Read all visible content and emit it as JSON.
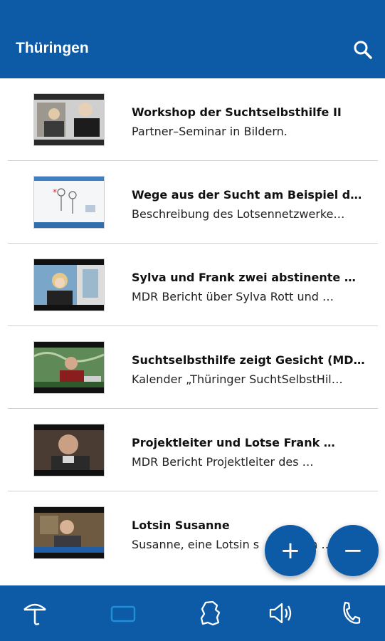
{
  "appbar": {
    "title": "Thüringen",
    "search_icon": "search-icon"
  },
  "items": [
    {
      "title": "Workshop der Suchtselbsthilfe II",
      "subtitle": "Partner–Seminar in Bildern."
    },
    {
      "title": "Wege aus der Sucht am Beispiel d…",
      "subtitle": "Beschreibung des Lotsennetzwerke…"
    },
    {
      "title": "Sylva und Frank   zwei abstinente …",
      "subtitle": "MDR Bericht über Sylva Rott und …"
    },
    {
      "title": "Suchtselbsthilfe zeigt Gesicht (MD…",
      "subtitle": "Kalender „Thüringer SuchtSelbstHil…"
    },
    {
      "title": "Projektleiter und Lotse Frank …",
      "subtitle": "MDR Bericht Projektleiter des …"
    },
    {
      "title": "Lotsin Susanne",
      "subtitle": "Susanne, eine Lotsin s",
      "subtitle_tail": "h …"
    }
  ],
  "fabs": {
    "zoom_in": "+",
    "zoom_out": "−"
  },
  "bottom_nav": [
    "umbrella-icon",
    "tablet-icon",
    "thuringia-map-icon",
    "speaker-icon",
    "phone-icon"
  ],
  "colors": {
    "primary": "#0d5ba6",
    "inactive_tab": "#1f8fd8"
  }
}
